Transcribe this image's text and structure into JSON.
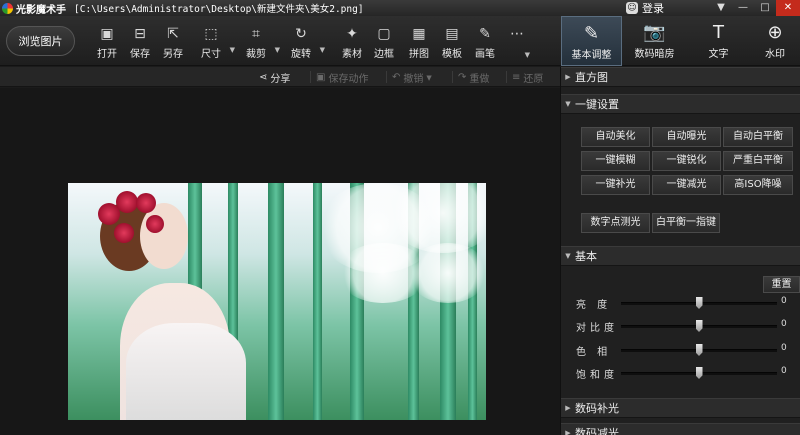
{
  "window": {
    "app_title": "光影魔术手",
    "path": "[C:\\Users\\Administrator\\Desktop\\新建文件夹\\美女2.png]",
    "login_label": "登录",
    "controls": [
      "▼",
      "—",
      "□",
      "✕"
    ]
  },
  "toolbar": {
    "browse_label": "浏览图片",
    "tools": [
      {
        "label": "打开",
        "icon": "open-image-icon",
        "glyph": "▣"
      },
      {
        "label": "保存",
        "icon": "save-icon",
        "glyph": "⊟"
      },
      {
        "label": "另存",
        "icon": "save-as-icon",
        "glyph": "⇱"
      },
      {
        "label": "尺寸",
        "icon": "resize-icon",
        "glyph": "⬚"
      },
      {
        "label": "裁剪",
        "icon": "crop-icon",
        "glyph": "⌗"
      },
      {
        "label": "旋转",
        "icon": "rotate-icon",
        "glyph": "↻"
      },
      {
        "label": "素材",
        "icon": "material-icon",
        "glyph": "✦"
      },
      {
        "label": "边框",
        "icon": "frame-icon",
        "glyph": "▢"
      },
      {
        "label": "拼图",
        "icon": "puzzle-icon",
        "glyph": "▦"
      },
      {
        "label": "模板",
        "icon": "template-icon",
        "glyph": "▤"
      },
      {
        "label": "画笔",
        "icon": "brush-icon",
        "glyph": "✎"
      },
      {
        "label": "",
        "icon": "more-icon",
        "glyph": "⋯"
      }
    ],
    "mode_tabs": [
      {
        "label": "基本调整",
        "icon": "basic-adjust-icon",
        "glyph": "✎"
      },
      {
        "label": "数码暗房",
        "icon": "darkroom-icon",
        "glyph": "📷"
      },
      {
        "label": "文字",
        "icon": "text-icon",
        "glyph": "T"
      },
      {
        "label": "水印",
        "icon": "watermark-icon",
        "glyph": "⊕"
      }
    ]
  },
  "actionbar": {
    "share": "分享",
    "save_action": "保存动作",
    "undo": "撤销",
    "redo": "重做",
    "restore": "还原"
  },
  "panel": {
    "histogram": "直方图",
    "one_click": "一键设置",
    "one_click_buttons": [
      "自动美化",
      "自动曝光",
      "自动白平衡",
      "一键模糊",
      "一键锐化",
      "严重白平衡",
      "一键补光",
      "一键减光",
      "高ISO降噪"
    ],
    "extra_buttons": [
      "数字点测光",
      "白平衡一指键"
    ],
    "basic": "基本",
    "reset": "重置",
    "sliders": [
      {
        "label": "亮 度",
        "value": "0",
        "level": 0.5
      },
      {
        "label": "对比度",
        "value": "0",
        "level": 0.5
      },
      {
        "label": "色 相",
        "value": "0",
        "level": 0.5
      },
      {
        "label": "饱和度",
        "value": "0",
        "level": 0.5
      }
    ],
    "digital_fill": "数码补光",
    "digital_reduce": "数码减光"
  }
}
